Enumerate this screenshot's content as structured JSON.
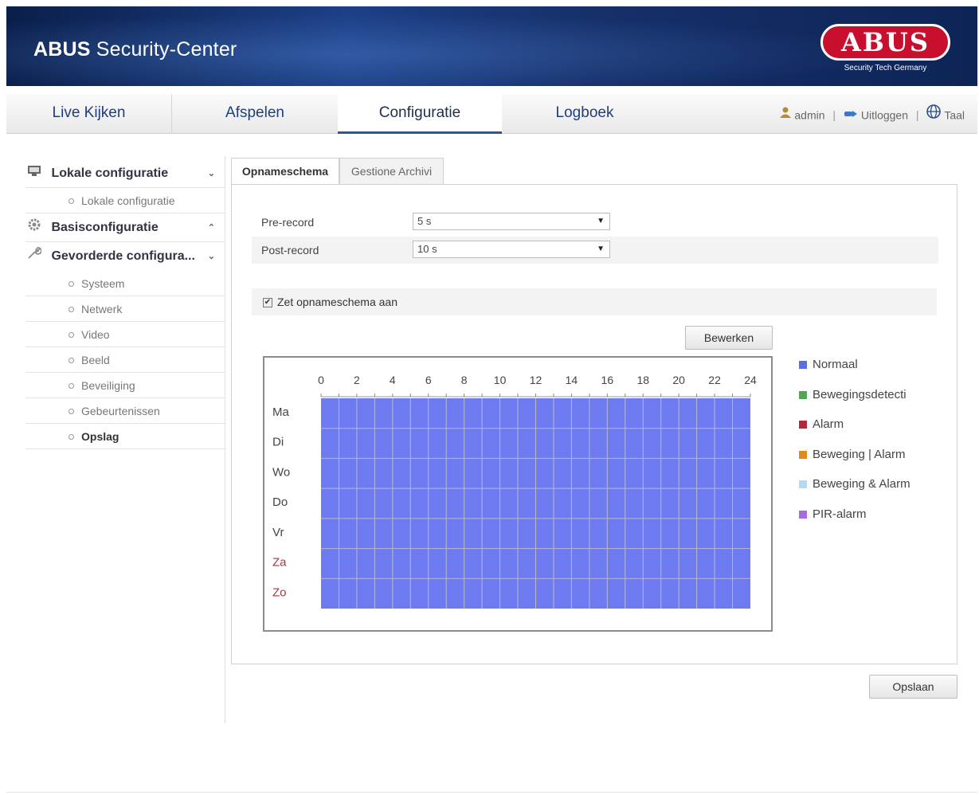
{
  "header": {
    "title_bold": "ABUS",
    "title_rest": " Security-Center",
    "logo_text": "ABUS",
    "logo_sub": "Security Tech Germany"
  },
  "nav": {
    "tabs": [
      {
        "label": "Live Kijken"
      },
      {
        "label": "Afspelen"
      },
      {
        "label": "Configuratie"
      },
      {
        "label": "Logboek"
      }
    ],
    "active_tab": "Configuratie",
    "user": "admin",
    "logout": "Uitloggen",
    "language": "Taal"
  },
  "sidebar": {
    "groups": [
      {
        "label": "Lokale configuratie",
        "icon": "monitor-icon",
        "items": [
          "Lokale configuratie"
        ]
      },
      {
        "label": "Basisconfiguratie",
        "icon": "gear-icon",
        "items": []
      },
      {
        "label": "Gevorderde configura...",
        "icon": "wrench-icon",
        "items": [
          "Systeem",
          "Netwerk",
          "Video",
          "Beeld",
          "Beveiliging",
          "Gebeurtenissen",
          "Opslag"
        ]
      }
    ],
    "active_item": "Opslag"
  },
  "content": {
    "subtabs": [
      {
        "label": "Opnameschema"
      },
      {
        "label": "Gestione Archivi"
      }
    ],
    "pre_record": {
      "label": "Pre-record",
      "value": "5 s"
    },
    "post_record": {
      "label": "Post-record",
      "value": "10 s"
    },
    "enable_schedule": {
      "label": "Zet opnameschema aan",
      "checked": true
    },
    "edit_button": "Bewerken",
    "save_button": "Opslaan"
  },
  "schedule": {
    "hours": [
      "0",
      "2",
      "4",
      "6",
      "8",
      "10",
      "12",
      "14",
      "16",
      "18",
      "20",
      "22",
      "24"
    ],
    "days": [
      {
        "label": "Ma",
        "weekend": false
      },
      {
        "label": "Di",
        "weekend": false
      },
      {
        "label": "Wo",
        "weekend": false
      },
      {
        "label": "Do",
        "weekend": false
      },
      {
        "label": "Vr",
        "weekend": false
      },
      {
        "label": "Za",
        "weekend": true
      },
      {
        "label": "Zo",
        "weekend": true
      }
    ],
    "fill_type": "Normaal",
    "fill_color": "#6e7bf0",
    "weekend_color": "#b03040"
  },
  "legend": [
    {
      "label": "Normaal",
      "color": "#5b6fe0"
    },
    {
      "label": "Bewegingsdetecti",
      "color": "#4fa84f"
    },
    {
      "label": "Alarm",
      "color": "#b3283a"
    },
    {
      "label": "Beweging | Alarm",
      "color": "#e08a1a"
    },
    {
      "label": "Beweging & Alarm",
      "color": "#b8d8f0"
    },
    {
      "label": "PIR-alarm",
      "color": "#a46cdc"
    }
  ]
}
